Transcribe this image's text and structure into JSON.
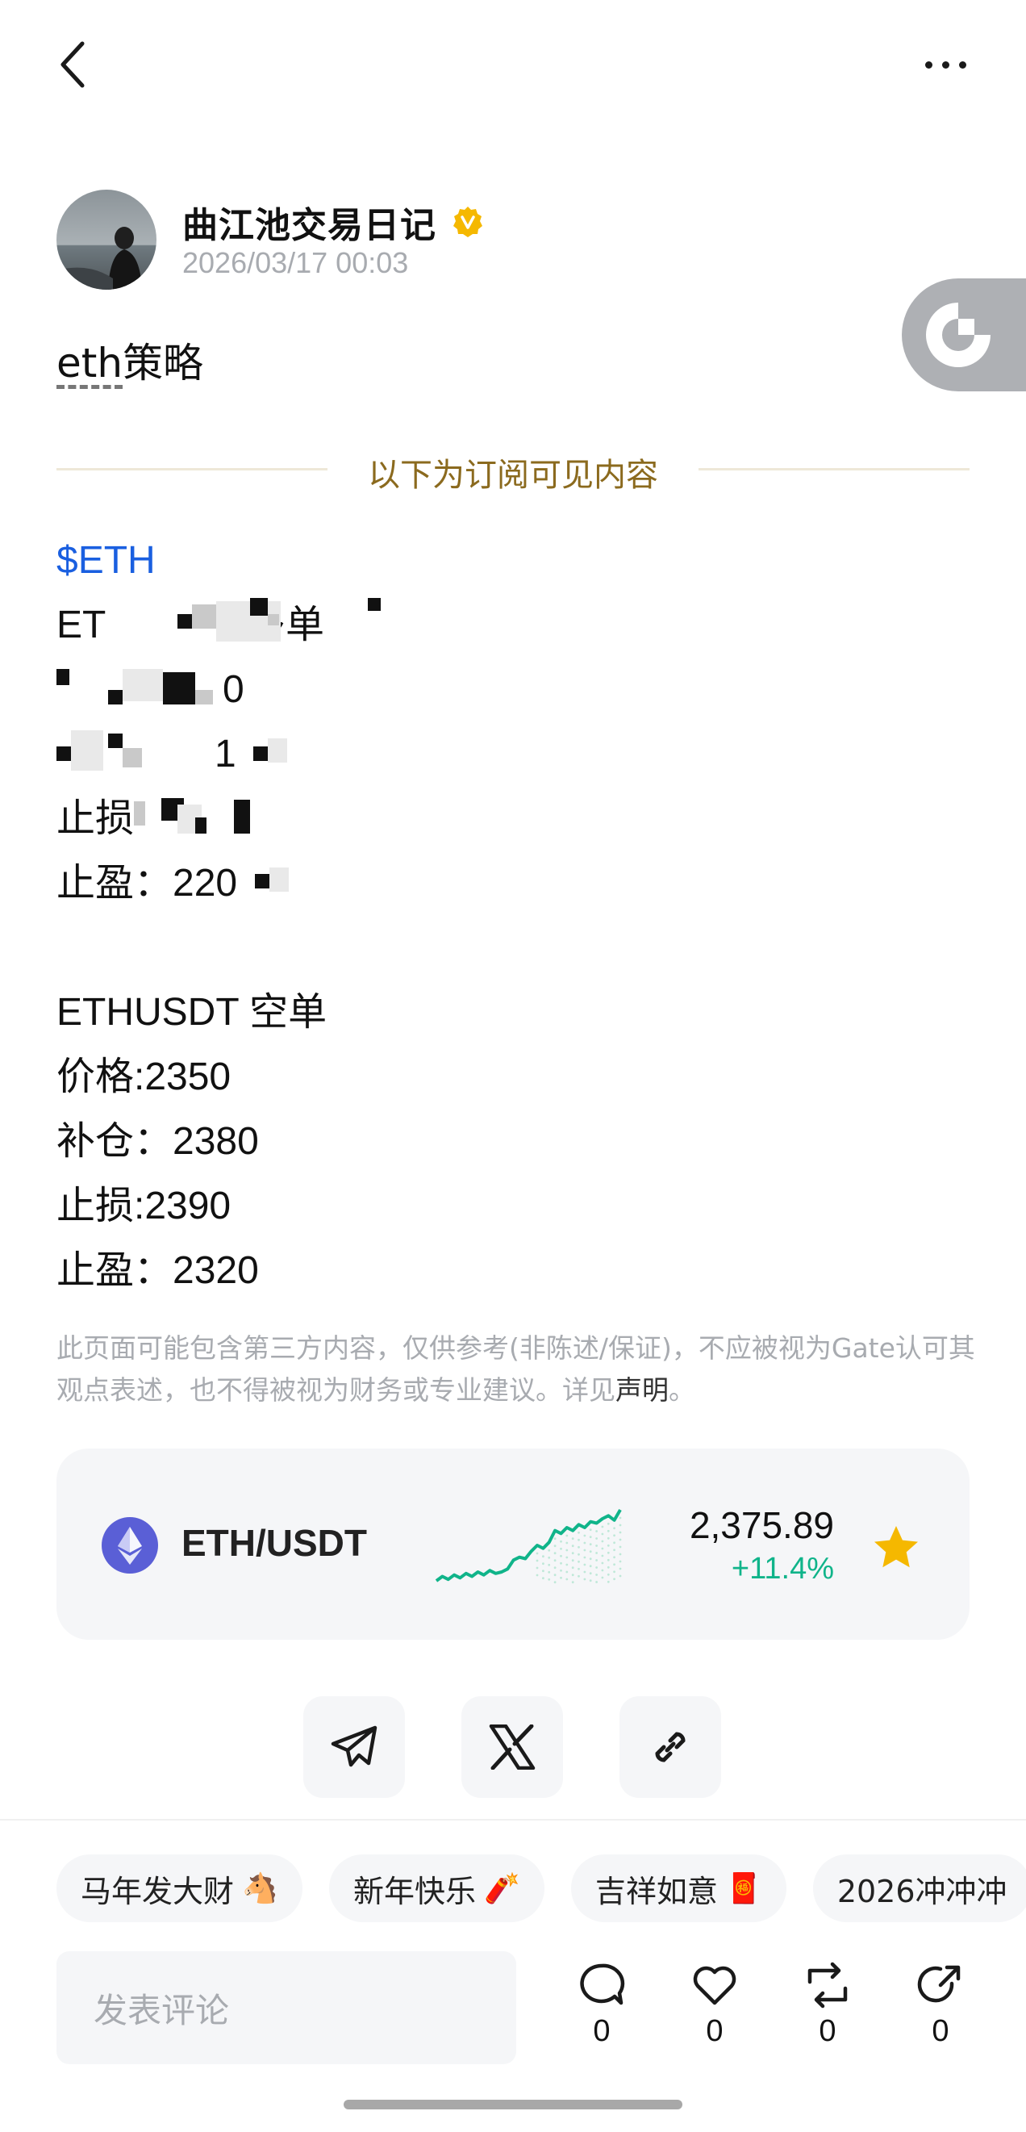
{
  "author": {
    "name": "曲江池交易日记",
    "time": "2026/03/17 00:03"
  },
  "post": {
    "title_prefix": "eth",
    "title_suffix": "策略",
    "divider_text": "以下为订阅可见内容",
    "lines": [
      {
        "text": "$ETH",
        "type": "tag"
      },
      {
        "text": "ET",
        "type": "redacted",
        "suffix": "多单"
      },
      {
        "text": "",
        "type": "redacted",
        "suffix": "0"
      },
      {
        "text": "",
        "type": "redacted",
        "suffix": "1"
      },
      {
        "text": "止损",
        "type": "redacted",
        "suffix": ""
      },
      {
        "text": "止盈：220",
        "type": "redacted",
        "suffix": ""
      },
      {
        "text": "",
        "type": "blank"
      },
      {
        "text": "ETHUSDT 空单",
        "type": "plain"
      },
      {
        "text": "价格:2350",
        "type": "plain"
      },
      {
        "text": "补仓：2380",
        "type": "plain"
      },
      {
        "text": "止损:2390",
        "type": "plain"
      },
      {
        "text": "止盈：2320",
        "type": "plain"
      }
    ],
    "disclaimer_text": "此页面可能包含第三方内容，仅供参考(非陈述/保证)，不应被视为Gate认可其观点表述，也不得被视为财务或专业建议。详见",
    "disclaimer_link": "声明",
    "disclaimer_end": "。"
  },
  "market": {
    "pair": "ETH/USDT",
    "price": "2,375.89",
    "change": "+11.4%",
    "trend_color": "#10b48a",
    "favorite_color": "#f5b800",
    "sparkline": [
      2.0,
      2.3,
      2.1,
      2.4,
      2.2,
      2.5,
      2.3,
      2.6,
      2.4,
      2.7,
      2.5,
      2.6,
      2.8,
      3.4,
      3.6,
      3.5,
      4.0,
      4.4,
      4.2,
      4.6,
      5.4,
      5.2,
      5.6,
      5.4,
      5.8,
      5.6,
      6.0,
      5.9,
      6.2,
      6.4,
      6.1,
      6.8
    ]
  },
  "share": {
    "icons": [
      "telegram-icon",
      "x-icon",
      "link-icon"
    ]
  },
  "topics": [
    {
      "label": "马年发大财",
      "emoji": "🐴"
    },
    {
      "label": "新年快乐",
      "emoji": "🧨"
    },
    {
      "label": "吉祥如意",
      "emoji": "🧧"
    },
    {
      "label": "2026冲冲冲",
      "emoji": ""
    }
  ],
  "comment": {
    "placeholder": "发表评论"
  },
  "actions": {
    "comments": "0",
    "likes": "0",
    "reposts": "0",
    "shares": "0"
  }
}
